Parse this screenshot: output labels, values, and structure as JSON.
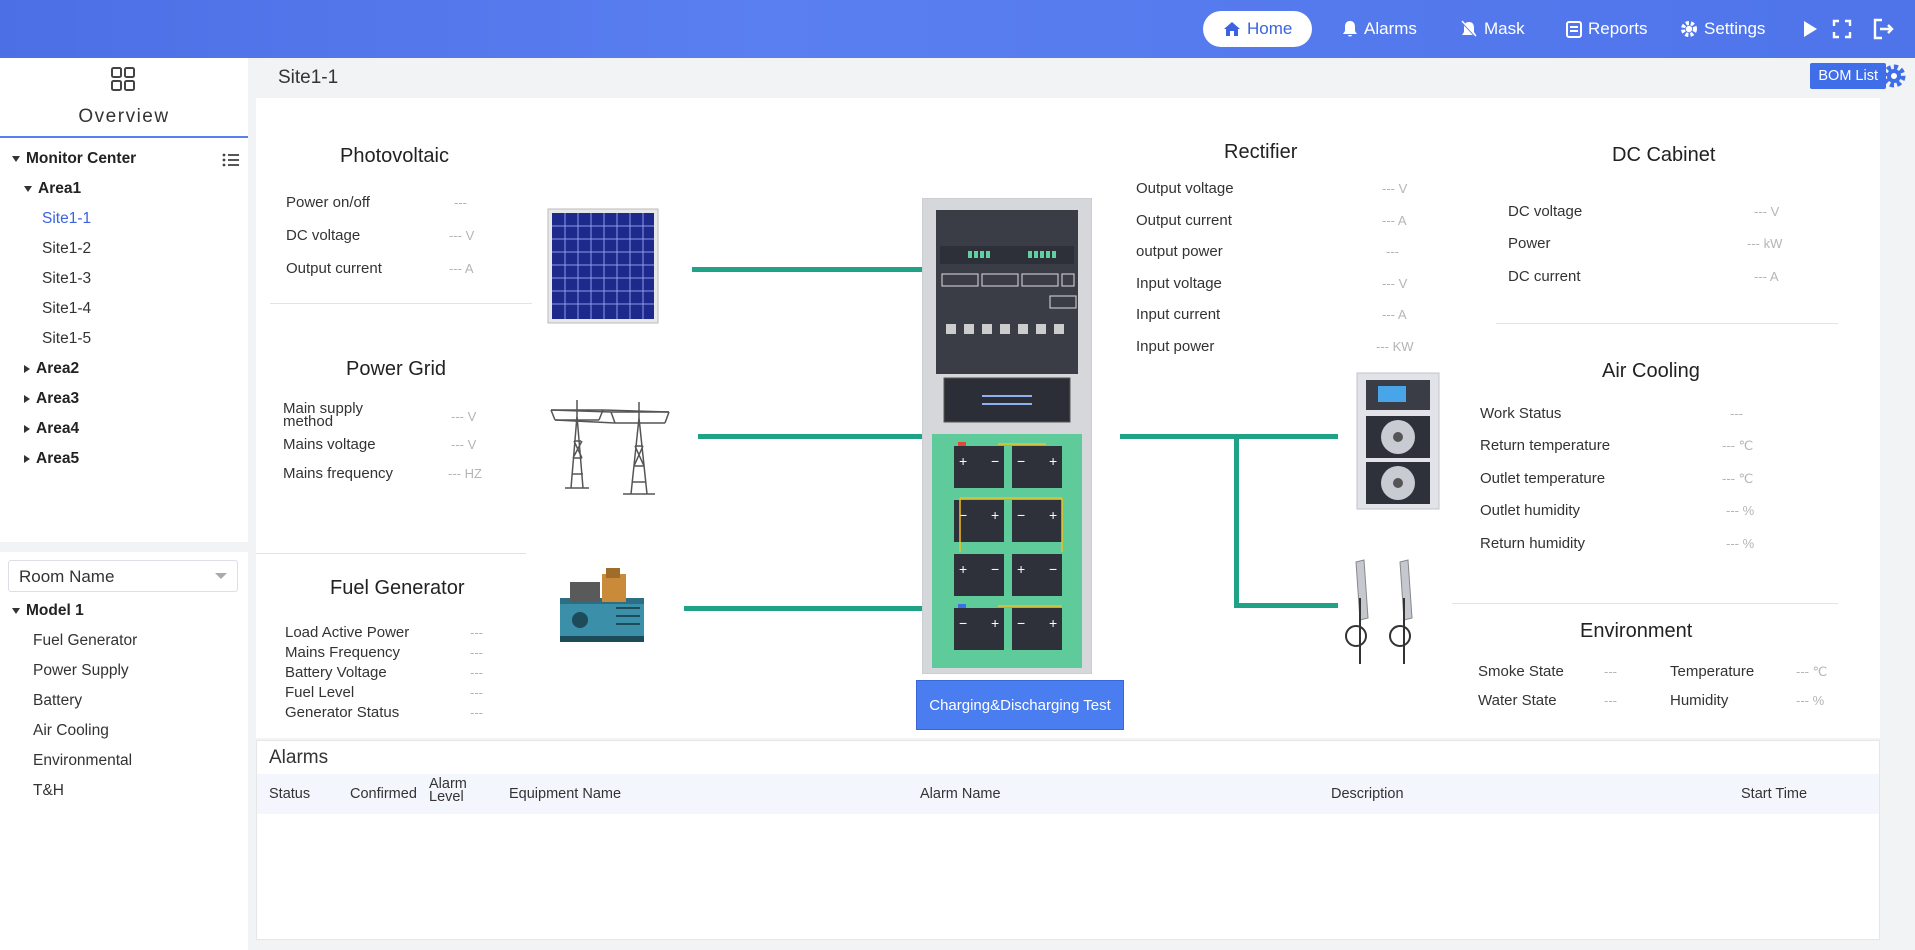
{
  "nav": {
    "items": [
      "Home",
      "Alarms",
      "Mask",
      "Reports",
      "Settings"
    ],
    "active": "Home"
  },
  "sidebar": {
    "overview": "Overview",
    "monitor_center": "Monitor Center",
    "areas": [
      {
        "label": "Area1",
        "expanded": true,
        "sites": [
          "Site1-1",
          "Site1-2",
          "Site1-3",
          "Site1-4",
          "Site1-5"
        ]
      },
      {
        "label": "Area2",
        "expanded": false
      },
      {
        "label": "Area3",
        "expanded": false
      },
      {
        "label": "Area4",
        "expanded": false
      },
      {
        "label": "Area5",
        "expanded": false
      }
    ],
    "selected_site": "Site1-1",
    "room_select": "Room Name",
    "model": "Model 1",
    "model_items": [
      "Fuel Generator",
      "Power Supply",
      "Battery",
      "Air Cooling",
      "Environmental",
      "T&H"
    ]
  },
  "header": {
    "site_title": "Site1-1",
    "bom_label": "BOM List"
  },
  "pv": {
    "title": "Photovoltaic",
    "rows": [
      {
        "label": "Power on/off",
        "value": "---"
      },
      {
        "label": "DC voltage",
        "value": "--- V"
      },
      {
        "label": "Output current",
        "value": "--- A"
      }
    ]
  },
  "grid": {
    "title": "Power Grid",
    "rows": [
      {
        "label": "Main supply method",
        "value": "--- V"
      },
      {
        "label": "Mains voltage",
        "value": "--- V"
      },
      {
        "label": "Mains frequency",
        "value": "--- HZ"
      }
    ]
  },
  "fuel": {
    "title": "Fuel Generator",
    "rows": [
      {
        "label": "Load Active Power",
        "value": "---"
      },
      {
        "label": "Mains Frequency",
        "value": "---"
      },
      {
        "label": "Battery Voltage",
        "value": "---"
      },
      {
        "label": "Fuel Level",
        "value": "---"
      },
      {
        "label": "Generator Status",
        "value": "---"
      }
    ]
  },
  "rectifier": {
    "title": "Rectifier",
    "rows": [
      {
        "label": "Output voltage",
        "value": "--- V"
      },
      {
        "label": "Output current",
        "value": "--- A"
      },
      {
        "label": "output power",
        "value": "---"
      },
      {
        "label": "Input voltage",
        "value": "--- V"
      },
      {
        "label": "Input current",
        "value": "--- A"
      },
      {
        "label": "Input power",
        "value": "--- KW"
      }
    ]
  },
  "dc": {
    "title": "DC Cabinet",
    "rows": [
      {
        "label": "DC voltage",
        "value": "--- V"
      },
      {
        "label": "Power",
        "value": "--- kW"
      },
      {
        "label": "DC current",
        "value": "--- A"
      }
    ]
  },
  "air": {
    "title": "Air Cooling",
    "rows": [
      {
        "label": "Work Status",
        "value": "---"
      },
      {
        "label": "Return temperature",
        "value": "--- ℃"
      },
      {
        "label": "Outlet temperature",
        "value": "--- ℃"
      },
      {
        "label": "Outlet humidity",
        "value": "--- %"
      },
      {
        "label": "Return humidity",
        "value": "--- %"
      }
    ]
  },
  "env": {
    "title": "Environment",
    "smoke": {
      "label": "Smoke State",
      "value": "---"
    },
    "temp": {
      "label": "Temperature",
      "value": "--- ℃"
    },
    "water": {
      "label": "Water State",
      "value": "---"
    },
    "hum": {
      "label": "Humidity",
      "value": "--- %"
    }
  },
  "test_button": "Charging&Discharging Test",
  "alarms": {
    "title": "Alarms",
    "columns": [
      "Status",
      "Confirmed",
      "Alarm Level",
      "Equipment Name",
      "Alarm Name",
      "Description",
      "Start Time"
    ]
  },
  "colors": {
    "accent": "#3b63e0",
    "wire": "#1fa285",
    "topbar": "#5a7ff0"
  }
}
